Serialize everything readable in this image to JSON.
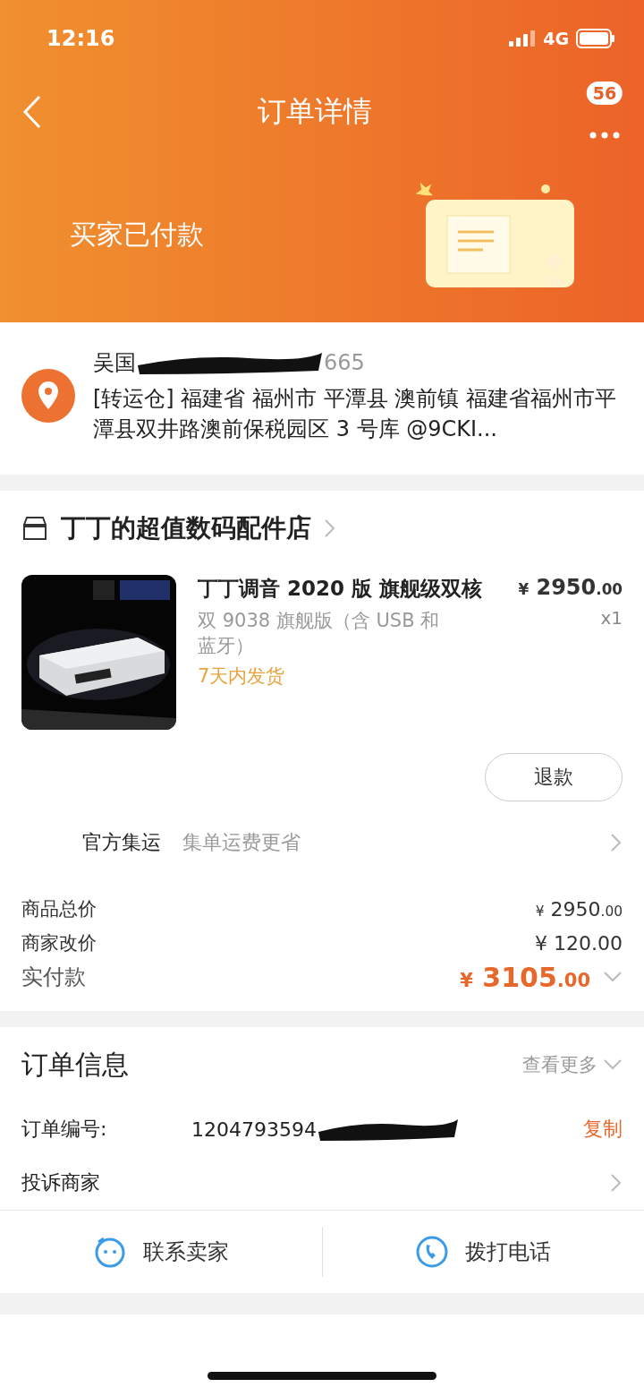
{
  "status_bar": {
    "time": "12:16",
    "network": "4G"
  },
  "header": {
    "title": "订单详情",
    "badge": "56",
    "status": "买家已付款"
  },
  "address": {
    "name": "吴国",
    "phone_tail": "665",
    "text": "[转运仓] 福建省 福州市 平潭县 澳前镇 福建省福州市平潭县双井路澳前保税园区 3 号库 @9CKI..."
  },
  "shop": {
    "name": "丁丁的超值数码配件店"
  },
  "item": {
    "kind": "picture",
    "title": "丁丁调音 2020 版 旗舰级双核",
    "variant": "双 9038 旗舰版（含 USB 和蓝牙）",
    "delivery": "7天内发货",
    "currency": "¥",
    "price_int": "2950",
    "price_dec": ".00",
    "qty": "x1",
    "action": "退款"
  },
  "shipping": {
    "label": "官方集运",
    "hint": "集单运费更省"
  },
  "totals": [
    {
      "label": "商品总价",
      "currency": "¥",
      "int": "2950",
      "dec": ".00",
      "kind": "small"
    },
    {
      "label": "商家改价",
      "currency": "¥",
      "int": "120.00",
      "kind": "plain"
    },
    {
      "label": "实付款",
      "currency": "¥",
      "int": "3105",
      "dec": ".00",
      "kind": "total"
    }
  ],
  "order_info": {
    "title": "订单信息",
    "more": "查看更多",
    "number_label": "订单编号:",
    "number": "1204793594",
    "copy": "复制",
    "complain": "投诉商家"
  },
  "actions": [
    {
      "label": "联系卖家",
      "kind": "chat"
    },
    {
      "label": "拨打电话",
      "kind": "phone"
    }
  ]
}
